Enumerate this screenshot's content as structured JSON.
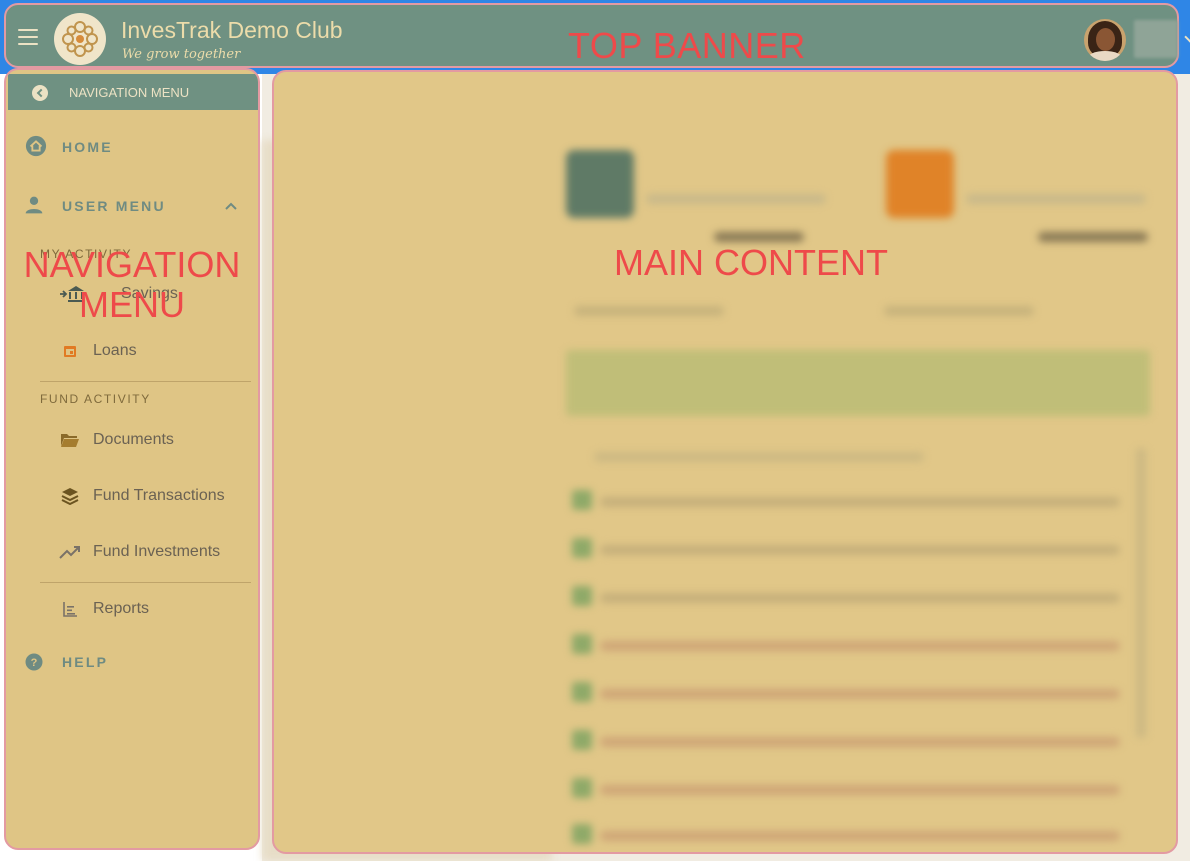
{
  "banner": {
    "title": "InvesTrak Demo Club",
    "subtitle": "We grow together",
    "region_label": "TOP BANNER"
  },
  "nav": {
    "header_label": "NAVIGATION MENU",
    "region_label_line1": "NAVIGATION",
    "region_label_line2": "MENU",
    "home": "HOME",
    "user_menu": "USER MENU",
    "my_activity": "MY ACTIVITY",
    "savings": "Savings",
    "loans": "Loans",
    "fund_activity": "FUND ACTIVITY",
    "documents": "Documents",
    "fund_transactions": "Fund Transactions",
    "fund_investments": "Fund Investments",
    "reports": "Reports",
    "help": "HELP"
  },
  "main": {
    "region_label": "MAIN CONTENT"
  },
  "colors": {
    "banner_bg": "#6f9182",
    "sidebar_bg": "#dfc585",
    "region_label": "#ee4a4a",
    "region_border": "#e39aa2",
    "accent_orange": "#e17a23"
  },
  "icons": {
    "menu": "hamburger-icon",
    "logo": "logo-icon",
    "back": "chevron-left-circle-icon",
    "home": "home-icon",
    "user": "person-icon",
    "expand": "chevron-up-icon",
    "savings": "bank-icon",
    "loans": "calendar-icon",
    "documents": "folder-open-icon",
    "fund_transactions": "layers-icon",
    "fund_investments": "trending-up-icon",
    "reports": "chart-icon",
    "help": "help-circle-icon"
  }
}
